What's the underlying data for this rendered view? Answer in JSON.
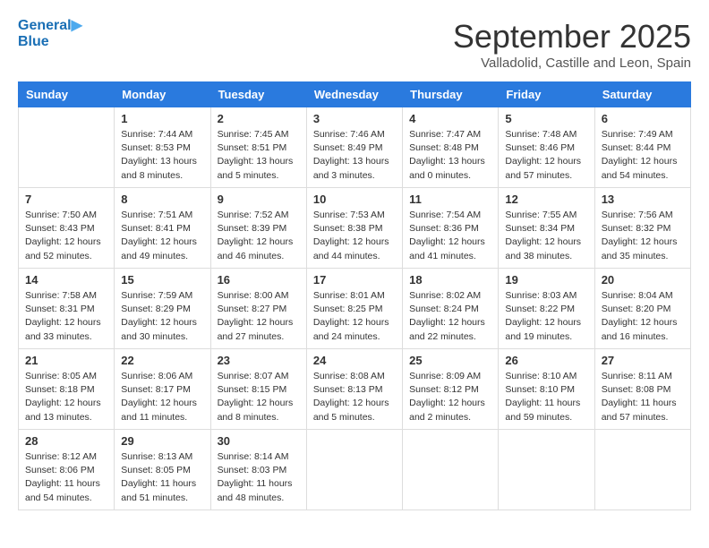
{
  "header": {
    "logo_line1": "General",
    "logo_line2": "Blue",
    "month_title": "September 2025",
    "location": "Valladolid, Castille and Leon, Spain"
  },
  "weekdays": [
    "Sunday",
    "Monday",
    "Tuesday",
    "Wednesday",
    "Thursday",
    "Friday",
    "Saturday"
  ],
  "weeks": [
    [
      {
        "num": "",
        "sunrise": "",
        "sunset": "",
        "daylight": ""
      },
      {
        "num": "1",
        "sunrise": "Sunrise: 7:44 AM",
        "sunset": "Sunset: 8:53 PM",
        "daylight": "Daylight: 13 hours and 8 minutes."
      },
      {
        "num": "2",
        "sunrise": "Sunrise: 7:45 AM",
        "sunset": "Sunset: 8:51 PM",
        "daylight": "Daylight: 13 hours and 5 minutes."
      },
      {
        "num": "3",
        "sunrise": "Sunrise: 7:46 AM",
        "sunset": "Sunset: 8:49 PM",
        "daylight": "Daylight: 13 hours and 3 minutes."
      },
      {
        "num": "4",
        "sunrise": "Sunrise: 7:47 AM",
        "sunset": "Sunset: 8:48 PM",
        "daylight": "Daylight: 13 hours and 0 minutes."
      },
      {
        "num": "5",
        "sunrise": "Sunrise: 7:48 AM",
        "sunset": "Sunset: 8:46 PM",
        "daylight": "Daylight: 12 hours and 57 minutes."
      },
      {
        "num": "6",
        "sunrise": "Sunrise: 7:49 AM",
        "sunset": "Sunset: 8:44 PM",
        "daylight": "Daylight: 12 hours and 54 minutes."
      }
    ],
    [
      {
        "num": "7",
        "sunrise": "Sunrise: 7:50 AM",
        "sunset": "Sunset: 8:43 PM",
        "daylight": "Daylight: 12 hours and 52 minutes."
      },
      {
        "num": "8",
        "sunrise": "Sunrise: 7:51 AM",
        "sunset": "Sunset: 8:41 PM",
        "daylight": "Daylight: 12 hours and 49 minutes."
      },
      {
        "num": "9",
        "sunrise": "Sunrise: 7:52 AM",
        "sunset": "Sunset: 8:39 PM",
        "daylight": "Daylight: 12 hours and 46 minutes."
      },
      {
        "num": "10",
        "sunrise": "Sunrise: 7:53 AM",
        "sunset": "Sunset: 8:38 PM",
        "daylight": "Daylight: 12 hours and 44 minutes."
      },
      {
        "num": "11",
        "sunrise": "Sunrise: 7:54 AM",
        "sunset": "Sunset: 8:36 PM",
        "daylight": "Daylight: 12 hours and 41 minutes."
      },
      {
        "num": "12",
        "sunrise": "Sunrise: 7:55 AM",
        "sunset": "Sunset: 8:34 PM",
        "daylight": "Daylight: 12 hours and 38 minutes."
      },
      {
        "num": "13",
        "sunrise": "Sunrise: 7:56 AM",
        "sunset": "Sunset: 8:32 PM",
        "daylight": "Daylight: 12 hours and 35 minutes."
      }
    ],
    [
      {
        "num": "14",
        "sunrise": "Sunrise: 7:58 AM",
        "sunset": "Sunset: 8:31 PM",
        "daylight": "Daylight: 12 hours and 33 minutes."
      },
      {
        "num": "15",
        "sunrise": "Sunrise: 7:59 AM",
        "sunset": "Sunset: 8:29 PM",
        "daylight": "Daylight: 12 hours and 30 minutes."
      },
      {
        "num": "16",
        "sunrise": "Sunrise: 8:00 AM",
        "sunset": "Sunset: 8:27 PM",
        "daylight": "Daylight: 12 hours and 27 minutes."
      },
      {
        "num": "17",
        "sunrise": "Sunrise: 8:01 AM",
        "sunset": "Sunset: 8:25 PM",
        "daylight": "Daylight: 12 hours and 24 minutes."
      },
      {
        "num": "18",
        "sunrise": "Sunrise: 8:02 AM",
        "sunset": "Sunset: 8:24 PM",
        "daylight": "Daylight: 12 hours and 22 minutes."
      },
      {
        "num": "19",
        "sunrise": "Sunrise: 8:03 AM",
        "sunset": "Sunset: 8:22 PM",
        "daylight": "Daylight: 12 hours and 19 minutes."
      },
      {
        "num": "20",
        "sunrise": "Sunrise: 8:04 AM",
        "sunset": "Sunset: 8:20 PM",
        "daylight": "Daylight: 12 hours and 16 minutes."
      }
    ],
    [
      {
        "num": "21",
        "sunrise": "Sunrise: 8:05 AM",
        "sunset": "Sunset: 8:18 PM",
        "daylight": "Daylight: 12 hours and 13 minutes."
      },
      {
        "num": "22",
        "sunrise": "Sunrise: 8:06 AM",
        "sunset": "Sunset: 8:17 PM",
        "daylight": "Daylight: 12 hours and 11 minutes."
      },
      {
        "num": "23",
        "sunrise": "Sunrise: 8:07 AM",
        "sunset": "Sunset: 8:15 PM",
        "daylight": "Daylight: 12 hours and 8 minutes."
      },
      {
        "num": "24",
        "sunrise": "Sunrise: 8:08 AM",
        "sunset": "Sunset: 8:13 PM",
        "daylight": "Daylight: 12 hours and 5 minutes."
      },
      {
        "num": "25",
        "sunrise": "Sunrise: 8:09 AM",
        "sunset": "Sunset: 8:12 PM",
        "daylight": "Daylight: 12 hours and 2 minutes."
      },
      {
        "num": "26",
        "sunrise": "Sunrise: 8:10 AM",
        "sunset": "Sunset: 8:10 PM",
        "daylight": "Daylight: 11 hours and 59 minutes."
      },
      {
        "num": "27",
        "sunrise": "Sunrise: 8:11 AM",
        "sunset": "Sunset: 8:08 PM",
        "daylight": "Daylight: 11 hours and 57 minutes."
      }
    ],
    [
      {
        "num": "28",
        "sunrise": "Sunrise: 8:12 AM",
        "sunset": "Sunset: 8:06 PM",
        "daylight": "Daylight: 11 hours and 54 minutes."
      },
      {
        "num": "29",
        "sunrise": "Sunrise: 8:13 AM",
        "sunset": "Sunset: 8:05 PM",
        "daylight": "Daylight: 11 hours and 51 minutes."
      },
      {
        "num": "30",
        "sunrise": "Sunrise: 8:14 AM",
        "sunset": "Sunset: 8:03 PM",
        "daylight": "Daylight: 11 hours and 48 minutes."
      },
      {
        "num": "",
        "sunrise": "",
        "sunset": "",
        "daylight": ""
      },
      {
        "num": "",
        "sunrise": "",
        "sunset": "",
        "daylight": ""
      },
      {
        "num": "",
        "sunrise": "",
        "sunset": "",
        "daylight": ""
      },
      {
        "num": "",
        "sunrise": "",
        "sunset": "",
        "daylight": ""
      }
    ]
  ]
}
